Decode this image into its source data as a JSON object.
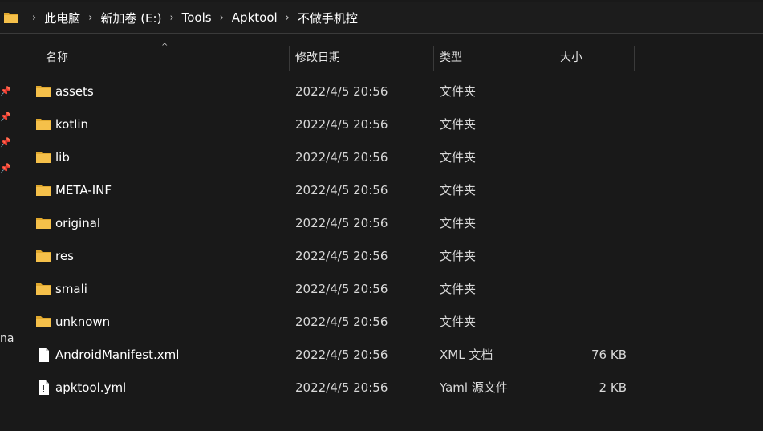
{
  "breadcrumb": [
    "此电脑",
    "新加卷 (E:)",
    "Tools",
    "Apktool",
    "不做手机控"
  ],
  "columns": {
    "name": "名称",
    "date": "修改日期",
    "type": "类型",
    "size": "大小"
  },
  "nav_cut_text": "na",
  "files": [
    {
      "name": "assets",
      "date": "2022/4/5 20:56",
      "type": "文件夹",
      "size": "",
      "icon": "folder-icon"
    },
    {
      "name": "kotlin",
      "date": "2022/4/5 20:56",
      "type": "文件夹",
      "size": "",
      "icon": "folder-icon"
    },
    {
      "name": "lib",
      "date": "2022/4/5 20:56",
      "type": "文件夹",
      "size": "",
      "icon": "folder-icon"
    },
    {
      "name": "META-INF",
      "date": "2022/4/5 20:56",
      "type": "文件夹",
      "size": "",
      "icon": "folder-icon"
    },
    {
      "name": "original",
      "date": "2022/4/5 20:56",
      "type": "文件夹",
      "size": "",
      "icon": "folder-icon"
    },
    {
      "name": "res",
      "date": "2022/4/5 20:56",
      "type": "文件夹",
      "size": "",
      "icon": "folder-icon"
    },
    {
      "name": "smali",
      "date": "2022/4/5 20:56",
      "type": "文件夹",
      "size": "",
      "icon": "folder-icon"
    },
    {
      "name": "unknown",
      "date": "2022/4/5 20:56",
      "type": "文件夹",
      "size": "",
      "icon": "folder-icon"
    },
    {
      "name": "AndroidManifest.xml",
      "date": "2022/4/5 20:56",
      "type": "XML 文档",
      "size": "76 KB",
      "icon": "file-icon"
    },
    {
      "name": "apktool.yml",
      "date": "2022/4/5 20:56",
      "type": "Yaml 源文件",
      "size": "2 KB",
      "icon": "yaml-file-icon"
    }
  ],
  "colors": {
    "background": "#191919",
    "folder": "#f5c04a",
    "folder_dark": "#e0a82e"
  }
}
